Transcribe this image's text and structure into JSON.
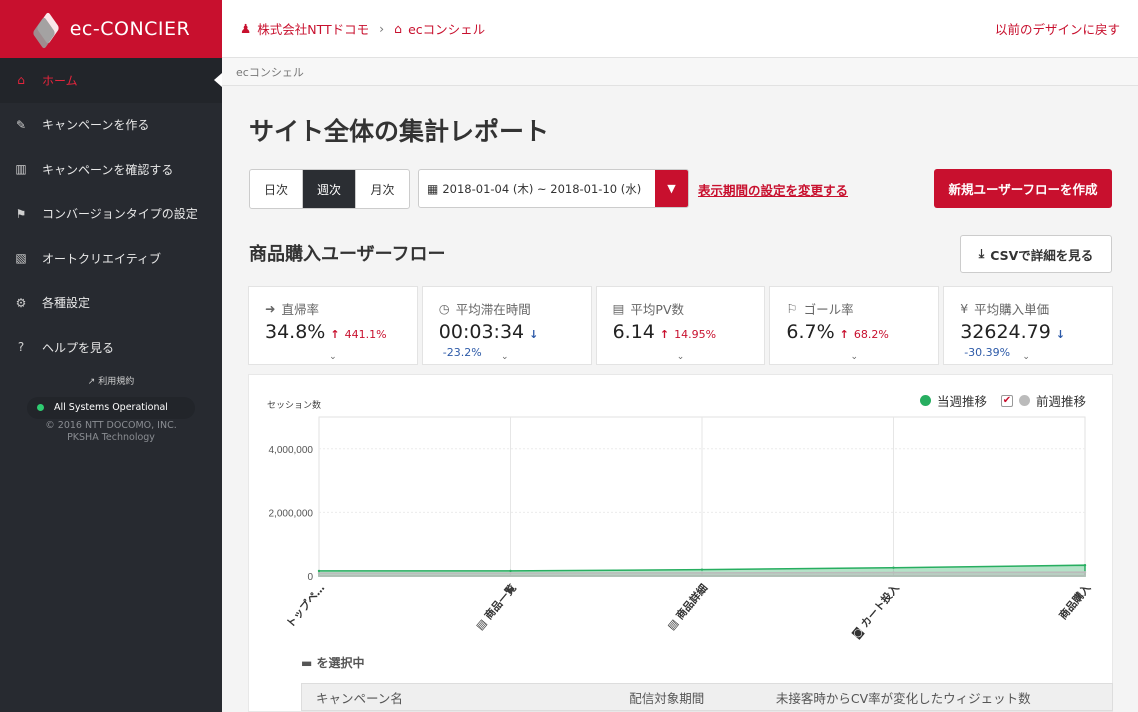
{
  "brand": {
    "name": "ec-CONCIER",
    "color": "#c8102e"
  },
  "topbar": {
    "org": "株式会社NTTドコモ",
    "separator": "›",
    "service": "ecコンシェル",
    "back_link": "以前のデザインに戻す"
  },
  "sidebar": {
    "items": [
      {
        "label": "ホーム",
        "icon": "home-icon",
        "glyph": "⌂"
      },
      {
        "label": "キャンペーンを作る",
        "icon": "edit-icon",
        "glyph": "✎"
      },
      {
        "label": "キャンペーンを確認する",
        "icon": "bar-chart-icon",
        "glyph": "▥"
      },
      {
        "label": "コンバージョンタイプの設定",
        "icon": "flag-icon",
        "glyph": "⚑"
      },
      {
        "label": "オートクリエイティブ",
        "icon": "image-icon",
        "glyph": "▧"
      },
      {
        "label": "各種設定",
        "icon": "gear-icon",
        "glyph": "⚙"
      },
      {
        "label": "ヘルプを見る",
        "icon": "help-icon",
        "glyph": "?"
      }
    ],
    "terms": "利用規約",
    "status": "All Systems Operational",
    "copyright": "© 2016 NTT DOCOMO, INC.",
    "partner": "PKSHA Technology"
  },
  "main": {
    "breadcrumb": "ecコンシェル",
    "title": "サイト全体の集計レポート",
    "periods": [
      "日次",
      "週次",
      "月次"
    ],
    "selected_period": "週次",
    "date_range": "2018-01-04 (木) ~ 2018-01-10 (水)",
    "change_period_link": "表示期間の設定を変更する",
    "new_flow_button": "新規ユーザーフローを作成",
    "section_title": "商品購入ユーザーフロー",
    "csv_button": "CSVで詳細を見る"
  },
  "kpis": [
    {
      "label": "直帰率",
      "icon": "exit-icon",
      "glyph": "➜",
      "value": "34.8%",
      "direction": "up",
      "delta": "441.1%"
    },
    {
      "label": "平均滞在時間",
      "icon": "clock-icon",
      "glyph": "◷",
      "value": "00:03:34",
      "direction": "down",
      "delta": "-23.2%"
    },
    {
      "label": "平均PV数",
      "icon": "page-view-icon",
      "glyph": "▤",
      "value": "6.14",
      "direction": "up",
      "delta": "14.95%"
    },
    {
      "label": "ゴール率",
      "icon": "goal-flag-icon",
      "glyph": "⚐",
      "value": "6.7%",
      "direction": "up",
      "delta": "68.2%"
    },
    {
      "label": "平均購入単価",
      "icon": "yen-icon",
      "glyph": "¥",
      "value": "32624.79",
      "direction": "down",
      "delta": "-30.39%"
    }
  ],
  "legend": {
    "current": "当週推移",
    "previous": "前週推移",
    "current_color": "#27ae60",
    "previous_color": "#bbbbbb"
  },
  "below_chart": {
    "selecting": "を選択中",
    "columns": [
      "キャンペーン名",
      "配信対象期間",
      "未接客時からCV率が変化したウィジェット数"
    ]
  },
  "chart_data": {
    "type": "area",
    "ylabel": "セッション数",
    "ylim": [
      0,
      5000000
    ],
    "y_ticks": [
      0,
      2000000,
      4000000
    ],
    "y_tick_labels": [
      "0",
      "2,000,000",
      "4,000,000"
    ],
    "categories": [
      "トップペ…",
      "商品一覧",
      "商品詳細",
      "カート投入",
      "商品購入"
    ],
    "category_icons": [
      null,
      "list-icon",
      "list-icon",
      "cart-icon",
      null
    ],
    "series": [
      {
        "name": "当週推移",
        "color": "#27ae60",
        "values": [
          160000,
          160000,
          200000,
          260000,
          340000
        ]
      },
      {
        "name": "前週推移",
        "color": "#bbbbbb",
        "values": [
          90000,
          90000,
          100000,
          110000,
          120000
        ]
      }
    ],
    "grid": true,
    "legend_position": "top-right"
  }
}
